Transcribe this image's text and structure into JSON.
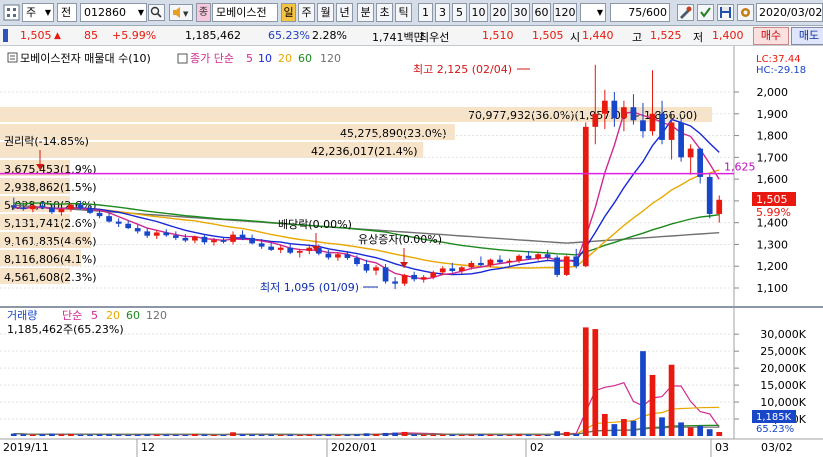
{
  "toolbar": {
    "market": "주",
    "view": "전",
    "code": "012860",
    "stock_name": "모베이스전",
    "period_active": "일",
    "periods": [
      "주",
      "월",
      "년",
      "분",
      "초",
      "틱"
    ],
    "intervals": [
      "1",
      "3",
      "5",
      "10",
      "20",
      "30",
      "60",
      "120"
    ],
    "count": "75",
    "count_total": "/600",
    "date": "2020/03/02"
  },
  "quote": {
    "price": "1,505",
    "change_arrow": "▲",
    "change": "85",
    "change_pct": "+5.99%",
    "volume": "1,185,462",
    "volume_ratio": "65.23%",
    "turnover": "2.28%",
    "amount": "1,741백만",
    "best_bid_label": "최우선",
    "best_bid": "1,510",
    "best_ask": "1,505",
    "open_label": "시",
    "open": "1,440",
    "high_label": "고",
    "high": "1,525",
    "low_label": "저",
    "low": "1,400",
    "buy_button": "매수",
    "sell_button": "매도"
  },
  "colors": {
    "up": "#e8190f",
    "down": "#1846c8",
    "ma5": "#d02890",
    "ma10": "#1828d8",
    "ma20": "#e8a800",
    "ma60": "#1d8a1d",
    "ma120": "#707070",
    "hline": "#e020e0"
  },
  "price_panel": {
    "title": "모베이스전자 매물대 수(10)",
    "ma_label": "종가 단순",
    "ma_periods": [
      "5",
      "10",
      "20",
      "60",
      "120"
    ],
    "lc": "LC:37.44",
    "hc": "HC:-29.18",
    "max_label": "최고 2,125 (02/04)",
    "min_label": "최저 1,095 (01/09)",
    "event_rights": "권리락(-14.85%)",
    "event_dividend": "배당락(0.00%)",
    "event_capital": "유상증자(0.00%)",
    "hline_value": "1,625",
    "current_price_label": "1,505",
    "current_change_label": "5.99%",
    "y_ticks": [
      "2,000",
      "1,900",
      "1,800",
      "1,700",
      "1,600",
      "1,500",
      "1,400",
      "1,300",
      "1,200",
      "1,100"
    ],
    "volume_profile": [
      {
        "label": "70,977,932(36.0%)(1,957.09 ~ 1,866.00)",
        "pct": 36.0
      },
      {
        "label": "45,275,890(23.0%)",
        "pct": 23.0
      },
      {
        "label": "42,236,017(21.4%)",
        "pct": 21.4
      },
      {
        "label": "3,675,453(1.9%)",
        "pct": 1.9
      },
      {
        "label": "2,938,862(1.5%)",
        "pct": 1.5
      },
      {
        "label": "5,028,050(2.6%)",
        "pct": 2.6
      },
      {
        "label": "5,131,741(2.6%)",
        "pct": 2.6
      },
      {
        "label": "9,161,835(4.6%)",
        "pct": 4.6
      },
      {
        "label": "8,116,806(4.1%)",
        "pct": 4.1
      },
      {
        "label": "4,561,608(2.3%)",
        "pct": 2.3
      }
    ]
  },
  "volume_panel": {
    "title": "거래량",
    "ma_label": "단순",
    "ma_periods": [
      "5",
      "20",
      "60",
      "120"
    ],
    "volume_text": "1,185,462주(65.23%)",
    "y_ticks": [
      "30,000K",
      "25,000K",
      "20,000K",
      "15,000K",
      "10,000K",
      "5,000K"
    ],
    "current_label": "1,185K",
    "current_pct": "65.23%"
  },
  "x_axis": {
    "labels": [
      "2019/11",
      "12",
      "2020/01",
      "02",
      "03"
    ],
    "date": "03/02"
  },
  "chart_data": {
    "type": "candlestick",
    "x": [
      "2019/11",
      "12",
      "2020/01",
      "02",
      "03"
    ],
    "ohlc": [
      [
        1480,
        1515,
        1460,
        1470
      ],
      [
        1470,
        1490,
        1455,
        1462
      ],
      [
        1462,
        1482,
        1448,
        1478
      ],
      [
        1478,
        1495,
        1462,
        1470
      ],
      [
        1470,
        1485,
        1440,
        1448
      ],
      [
        1448,
        1470,
        1432,
        1462
      ],
      [
        1462,
        1490,
        1450,
        1482
      ],
      [
        1482,
        1500,
        1460,
        1465
      ],
      [
        1465,
        1480,
        1440,
        1445
      ],
      [
        1445,
        1460,
        1420,
        1430
      ],
      [
        1430,
        1445,
        1400,
        1405
      ],
      [
        1405,
        1420,
        1380,
        1395
      ],
      [
        1395,
        1410,
        1370,
        1375
      ],
      [
        1375,
        1390,
        1350,
        1360
      ],
      [
        1360,
        1375,
        1330,
        1340
      ],
      [
        1340,
        1365,
        1325,
        1355
      ],
      [
        1355,
        1370,
        1335,
        1342
      ],
      [
        1342,
        1360,
        1320,
        1330
      ],
      [
        1330,
        1348,
        1310,
        1318
      ],
      [
        1318,
        1340,
        1305,
        1335
      ],
      [
        1335,
        1345,
        1300,
        1310
      ],
      [
        1310,
        1330,
        1295,
        1320
      ],
      [
        1320,
        1335,
        1305,
        1312
      ],
      [
        1312,
        1360,
        1300,
        1345
      ],
      [
        1345,
        1365,
        1320,
        1330
      ],
      [
        1330,
        1345,
        1300,
        1305
      ],
      [
        1305,
        1325,
        1280,
        1290
      ],
      [
        1290,
        1310,
        1270,
        1275
      ],
      [
        1275,
        1295,
        1260,
        1285
      ],
      [
        1285,
        1300,
        1255,
        1262
      ],
      [
        1262,
        1280,
        1240,
        1270
      ],
      [
        1270,
        1295,
        1255,
        1285
      ],
      [
        1285,
        1300,
        1250,
        1258
      ],
      [
        1258,
        1275,
        1230,
        1240
      ],
      [
        1240,
        1265,
        1225,
        1255
      ],
      [
        1255,
        1270,
        1230,
        1238
      ],
      [
        1238,
        1250,
        1200,
        1210
      ],
      [
        1210,
        1230,
        1170,
        1180
      ],
      [
        1180,
        1205,
        1160,
        1195
      ],
      [
        1195,
        1210,
        1120,
        1130
      ],
      [
        1130,
        1150,
        1095,
        1120
      ],
      [
        1120,
        1165,
        1110,
        1160
      ],
      [
        1160,
        1175,
        1130,
        1140
      ],
      [
        1140,
        1160,
        1125,
        1150
      ],
      [
        1150,
        1180,
        1140,
        1172
      ],
      [
        1172,
        1200,
        1160,
        1190
      ],
      [
        1190,
        1215,
        1170,
        1178
      ],
      [
        1178,
        1200,
        1165,
        1195
      ],
      [
        1195,
        1225,
        1185,
        1215
      ],
      [
        1215,
        1245,
        1200,
        1205
      ],
      [
        1205,
        1235,
        1195,
        1230
      ],
      [
        1230,
        1250,
        1210,
        1218
      ],
      [
        1218,
        1235,
        1195,
        1225
      ],
      [
        1225,
        1255,
        1215,
        1248
      ],
      [
        1248,
        1270,
        1230,
        1235
      ],
      [
        1235,
        1260,
        1225,
        1255
      ],
      [
        1255,
        1275,
        1230,
        1240
      ],
      [
        1240,
        1250,
        1150,
        1160
      ],
      [
        1160,
        1250,
        1155,
        1245
      ],
      [
        1245,
        1280,
        1190,
        1200
      ],
      [
        1200,
        1860,
        1195,
        1840
      ],
      [
        1840,
        2125,
        1760,
        1900
      ],
      [
        1900,
        2010,
        1830,
        1960
      ],
      [
        1960,
        2000,
        1840,
        1880
      ],
      [
        1880,
        1960,
        1820,
        1930
      ],
      [
        1930,
        1990,
        1850,
        1870
      ],
      [
        1870,
        1950,
        1790,
        1820
      ],
      [
        1820,
        2100,
        1800,
        1900
      ],
      [
        1900,
        1960,
        1760,
        1780
      ],
      [
        1780,
        1900,
        1690,
        1860
      ],
      [
        1860,
        1880,
        1680,
        1700
      ],
      [
        1700,
        1760,
        1620,
        1740
      ],
      [
        1740,
        1745,
        1580,
        1610
      ],
      [
        1610,
        1625,
        1420,
        1440
      ],
      [
        1440,
        1525,
        1400,
        1505
      ]
    ],
    "volume_k": [
      700,
      500,
      400,
      500,
      700,
      500,
      600,
      400,
      400,
      500,
      500,
      400,
      300,
      400,
      500,
      400,
      400,
      300,
      300,
      600,
      400,
      300,
      300,
      1100,
      500,
      400,
      400,
      400,
      300,
      400,
      300,
      400,
      300,
      400,
      300,
      400,
      500,
      800,
      600,
      900,
      1000,
      1200,
      500,
      400,
      400,
      400,
      400,
      300,
      400,
      500,
      400,
      300,
      300,
      500,
      400,
      300,
      300,
      1400,
      1200,
      600,
      32000,
      31500,
      6500,
      3500,
      5000,
      4500,
      25000,
      18000,
      5500,
      21000,
      4000,
      2500,
      3000,
      2000,
      1185
    ],
    "hline": 1625,
    "ylim": [
      1050,
      2100
    ],
    "volume_ylim": [
      0,
      33000
    ]
  }
}
